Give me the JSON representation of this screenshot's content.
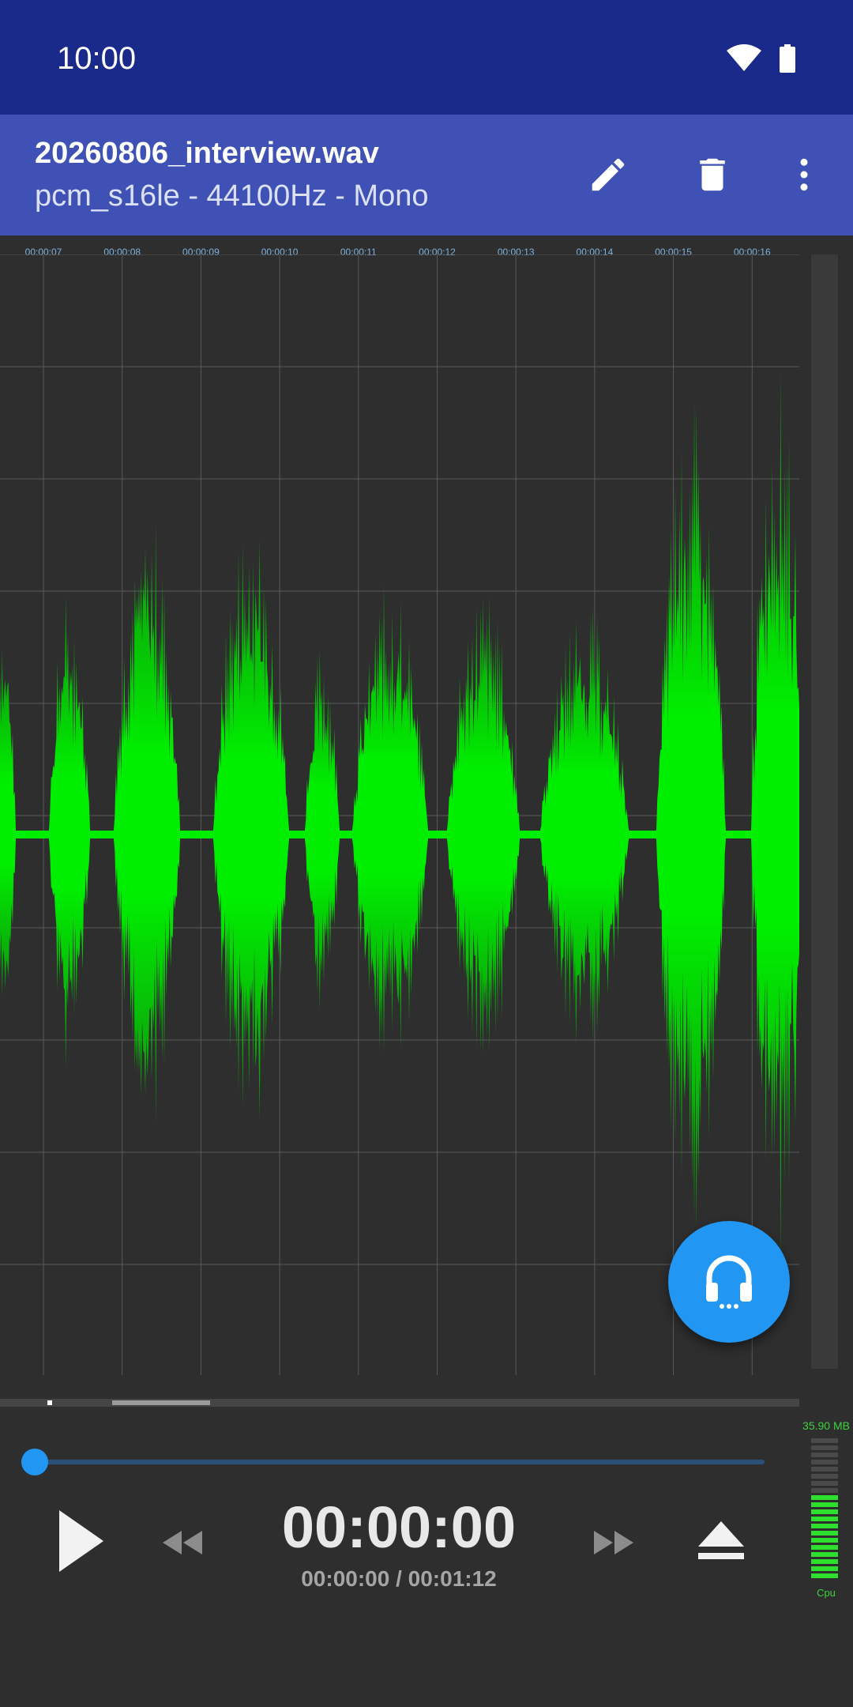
{
  "status_bar": {
    "time": "10:00"
  },
  "app_bar": {
    "title": "20260806_interview.wav",
    "subtitle": "pcm_s16le - 44100Hz - Mono",
    "actions": [
      {
        "name": "edit",
        "icon": "pencil-icon"
      },
      {
        "name": "delete",
        "icon": "trash-icon"
      },
      {
        "name": "more",
        "icon": "more-vert-icon"
      }
    ]
  },
  "timeline": {
    "labels": [
      "00:00:07",
      "00:00:08",
      "00:00:09",
      "00:00:10",
      "00:00:11",
      "00:00:12",
      "00:00:13",
      "00:00:14",
      "00:00:15",
      "00:00:16"
    ]
  },
  "waveform": {
    "color": "#00ee00"
  },
  "playback": {
    "position_fraction": 0.0,
    "current_big": "00:00:00",
    "current_and_total": "00:00:00 / 00:01:12"
  },
  "controls": {
    "play": "play-icon",
    "rewind": "rewind-icon",
    "fast_forward": "fast-forward-icon",
    "eject": "eject-icon",
    "monitor": "headphones-icon"
  },
  "meter": {
    "memory": "35.90 MB",
    "label": "Cpu",
    "level_fraction": 0.62
  },
  "colors": {
    "accent": "#2196f3",
    "app_bar": "#3f51b5",
    "status_bar": "#1a2a8a",
    "background": "#2e2e2e"
  }
}
